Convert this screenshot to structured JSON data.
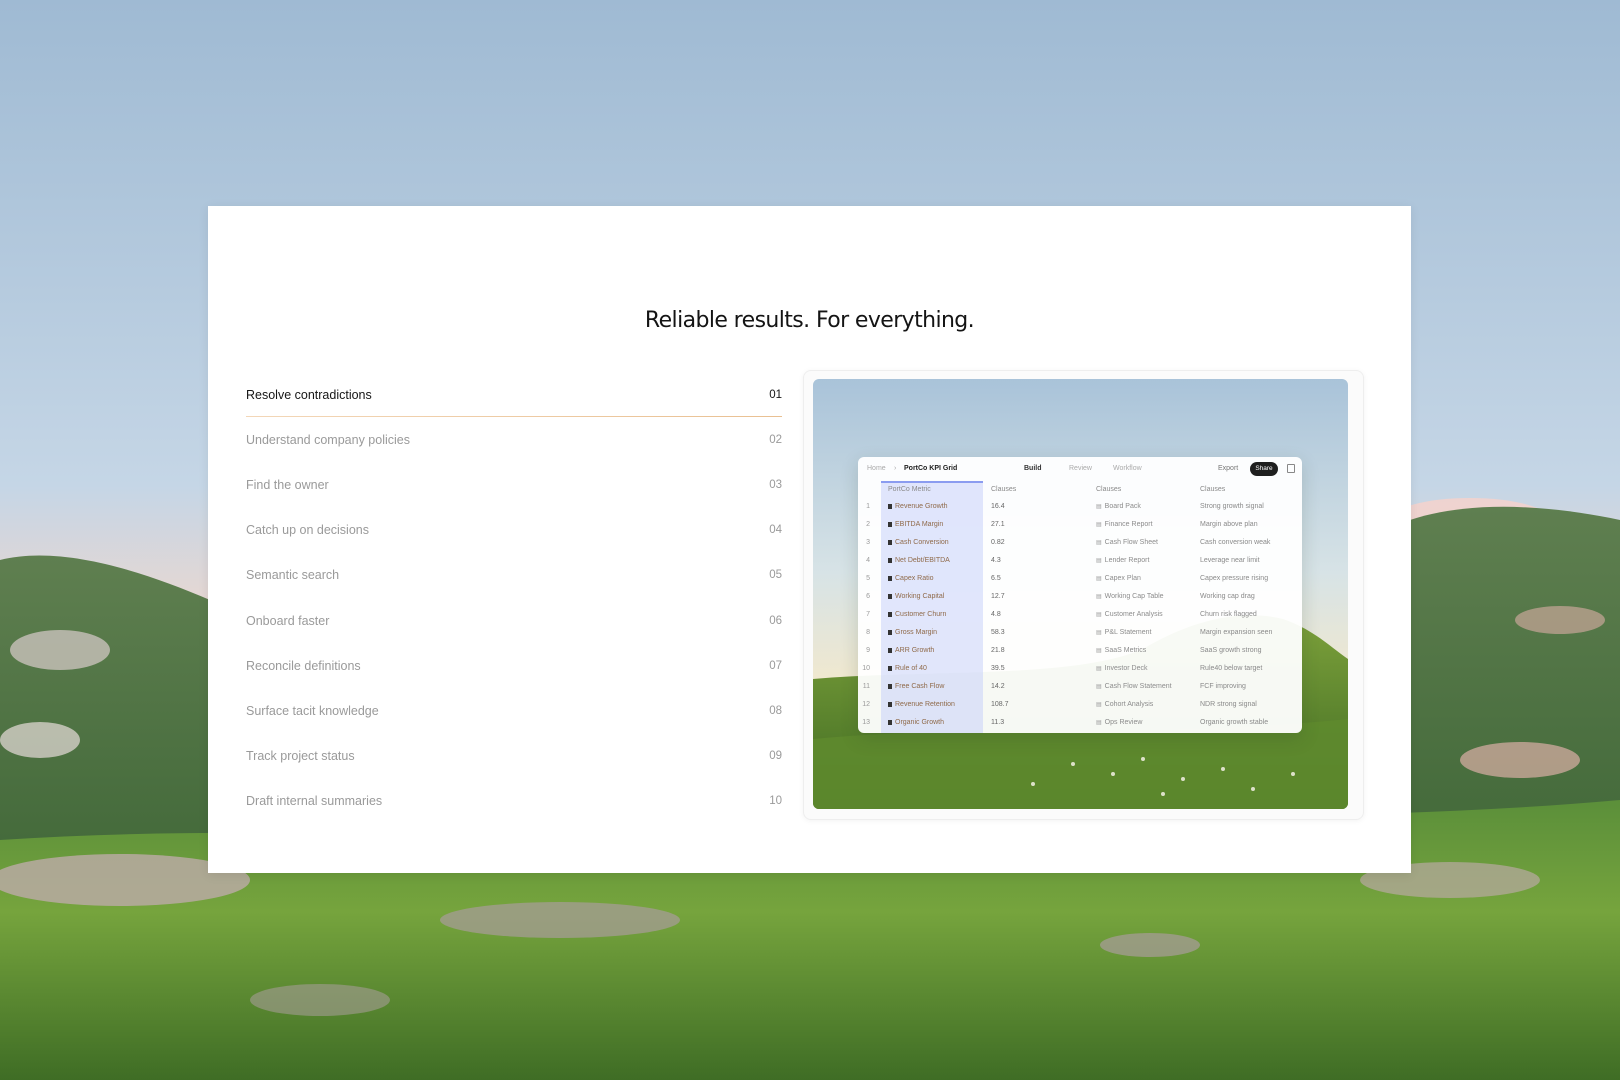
{
  "headline": "Reliable results. For everything.",
  "features": [
    {
      "label": "Resolve contradictions",
      "num": "01",
      "active": true
    },
    {
      "label": "Understand company policies",
      "num": "02"
    },
    {
      "label": "Find the owner",
      "num": "03"
    },
    {
      "label": "Catch up on decisions",
      "num": "04"
    },
    {
      "label": "Semantic search",
      "num": "05"
    },
    {
      "label": "Onboard faster",
      "num": "06"
    },
    {
      "label": "Reconcile definitions",
      "num": "07"
    },
    {
      "label": "Surface tacit knowledge",
      "num": "08"
    },
    {
      "label": "Track project status",
      "num": "09"
    },
    {
      "label": "Draft internal summaries",
      "num": "10"
    }
  ],
  "preview": {
    "breadcrumb": {
      "home": "Home",
      "sep": "›",
      "title": "PortCo KPI Grid"
    },
    "tabs": [
      "Build",
      "Review",
      "Workflow"
    ],
    "active_tab": "Build",
    "export_label": "Export",
    "share_label": "Share",
    "columns": [
      "PortCo Metric",
      "Clauses",
      "Clauses",
      "Clauses"
    ],
    "rows": [
      {
        "n": "1",
        "metric": "Revenue Growth",
        "value": "16.4",
        "source": "Board Pack",
        "note": "Strong growth signal"
      },
      {
        "n": "2",
        "metric": "EBITDA Margin",
        "value": "27.1",
        "source": "Finance Report",
        "note": "Margin above plan"
      },
      {
        "n": "3",
        "metric": "Cash Conversion",
        "value": "0.82",
        "source": "Cash Flow Sheet",
        "note": "Cash conversion weak"
      },
      {
        "n": "4",
        "metric": "Net Debt/EBITDA",
        "value": "4.3",
        "source": "Lender Report",
        "note": "Leverage near limit"
      },
      {
        "n": "5",
        "metric": "Capex Ratio",
        "value": "6.5",
        "source": "Capex Plan",
        "note": "Capex pressure rising"
      },
      {
        "n": "6",
        "metric": "Working Capital",
        "value": "12.7",
        "source": "Working Cap Table",
        "note": "Working cap drag"
      },
      {
        "n": "7",
        "metric": "Customer Churn",
        "value": "4.8",
        "source": "Customer Analysis",
        "note": "Churn risk flagged"
      },
      {
        "n": "8",
        "metric": "Gross Margin",
        "value": "58.3",
        "source": "P&L Statement",
        "note": "Margin expansion seen"
      },
      {
        "n": "9",
        "metric": "ARR Growth",
        "value": "21.8",
        "source": "SaaS Metrics",
        "note": "SaaS growth strong"
      },
      {
        "n": "10",
        "metric": "Rule of 40",
        "value": "39.5",
        "source": "Investor Deck",
        "note": "Rule40 below target"
      },
      {
        "n": "11",
        "metric": "Free Cash Flow",
        "value": "14.2",
        "source": "Cash Flow Statement",
        "note": "FCF improving"
      },
      {
        "n": "12",
        "metric": "Revenue Retention",
        "value": "108.7",
        "source": "Cohort Analysis",
        "note": "NDR strong signal"
      },
      {
        "n": "13",
        "metric": "Organic Growth",
        "value": "11.3",
        "source": "Ops Review",
        "note": "Organic growth stable"
      }
    ]
  }
}
